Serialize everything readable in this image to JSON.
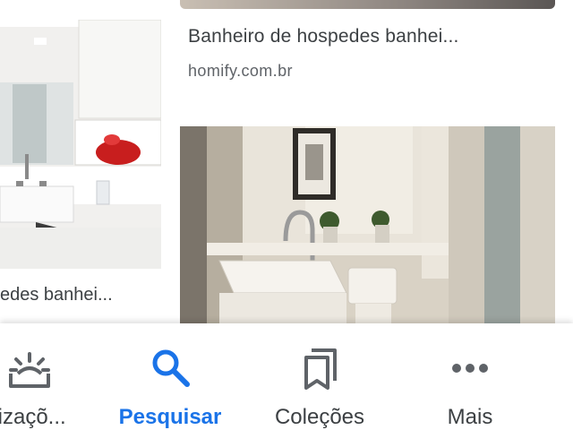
{
  "results": {
    "left": {
      "title": "edes banhei..."
    },
    "right_top": {
      "title": "Banheiro de hospedes banhei...",
      "source": "homify.com.br"
    }
  },
  "bottom_nav": {
    "items": [
      {
        "label": "lizaçõ...",
        "icon": "updates-icon"
      },
      {
        "label": "Pesquisar",
        "icon": "search-icon",
        "active": true
      },
      {
        "label": "Coleções",
        "icon": "bookmarks-icon"
      },
      {
        "label": "Mais",
        "icon": "more-icon"
      }
    ]
  },
  "colors": {
    "accent": "#1a73e8",
    "text": "#3c4043",
    "secondary_text": "#5f6368"
  }
}
